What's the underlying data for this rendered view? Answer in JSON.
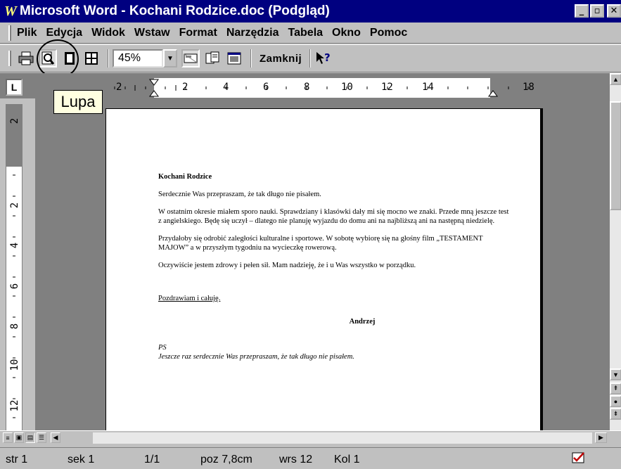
{
  "window": {
    "app_letter": "W",
    "title": "Microsoft Word - Kochani Rodzice.doc (Podgląd)",
    "btn_minimize": "_",
    "btn_restore": "▫",
    "btn_close": "✕"
  },
  "menu": [
    "Plik",
    "Edycja",
    "Widok",
    "Wstaw",
    "Format",
    "Narzędzia",
    "Tabela",
    "Okno",
    "Pomoc"
  ],
  "toolbar": {
    "zoom_value": "45%",
    "close_label": "Zamknij",
    "icons": [
      "printer-icon",
      "magnifier-icon",
      "one-page-icon",
      "multiple-pages-icon",
      "zoom-dropdown",
      "view-ruler-icon",
      "shrink-to-fit-icon",
      "full-screen-icon",
      "close-button",
      "help-icon"
    ]
  },
  "tooltip": "Lupa",
  "ruler": {
    "tab_selector": "L",
    "h_labels": [
      "2",
      "2",
      "4",
      "6",
      "8",
      "10",
      "12",
      "14",
      "18"
    ],
    "v_labels": [
      "2",
      "2",
      "4",
      "6",
      "8",
      "10",
      "12"
    ]
  },
  "document": {
    "heading": "Kochani Rodzice",
    "p1": "Serdecznie Was przepraszam, że tak długo nie pisałem.",
    "p2": "W ostatnim okresie miałem sporo nauki. Sprawdziany i klasówki dały mi się mocno we znaki. Przede mną jeszcze test z angielskiego. Będę się uczył – dlatego nie planuję wyjazdu do domu ani na najbliższą ani na następną niedzielę.",
    "p3": "Przydałoby się odrobić zaległości kulturalne i sportowe. W sobotę wybiorę się na głośny film „TESTAMENT MAJOW” a w przyszłym tygodniu na wycieczkę rowerową.",
    "p4": "Oczywiście jestem zdrowy i pełen sił. Mam nadzieję, że i u Was wszystko w porządku.",
    "closing": "Pozdrawiam i całuję.",
    "signature": "Andrzej",
    "ps_label": "PS",
    "ps_text": "Jeszcze raz serdecznie Was przepraszam, że tak długo nie pisałem."
  },
  "status": {
    "page": "str 1",
    "section": "sek 1",
    "pages": "1/1",
    "position": "poz 7,8cm",
    "line": "wrs 12",
    "column": "Kol 1"
  },
  "colors": {
    "title_bar": "#000080",
    "chrome": "#c0c0c0",
    "workspace": "#808080",
    "tooltip": "#ffffe1"
  }
}
